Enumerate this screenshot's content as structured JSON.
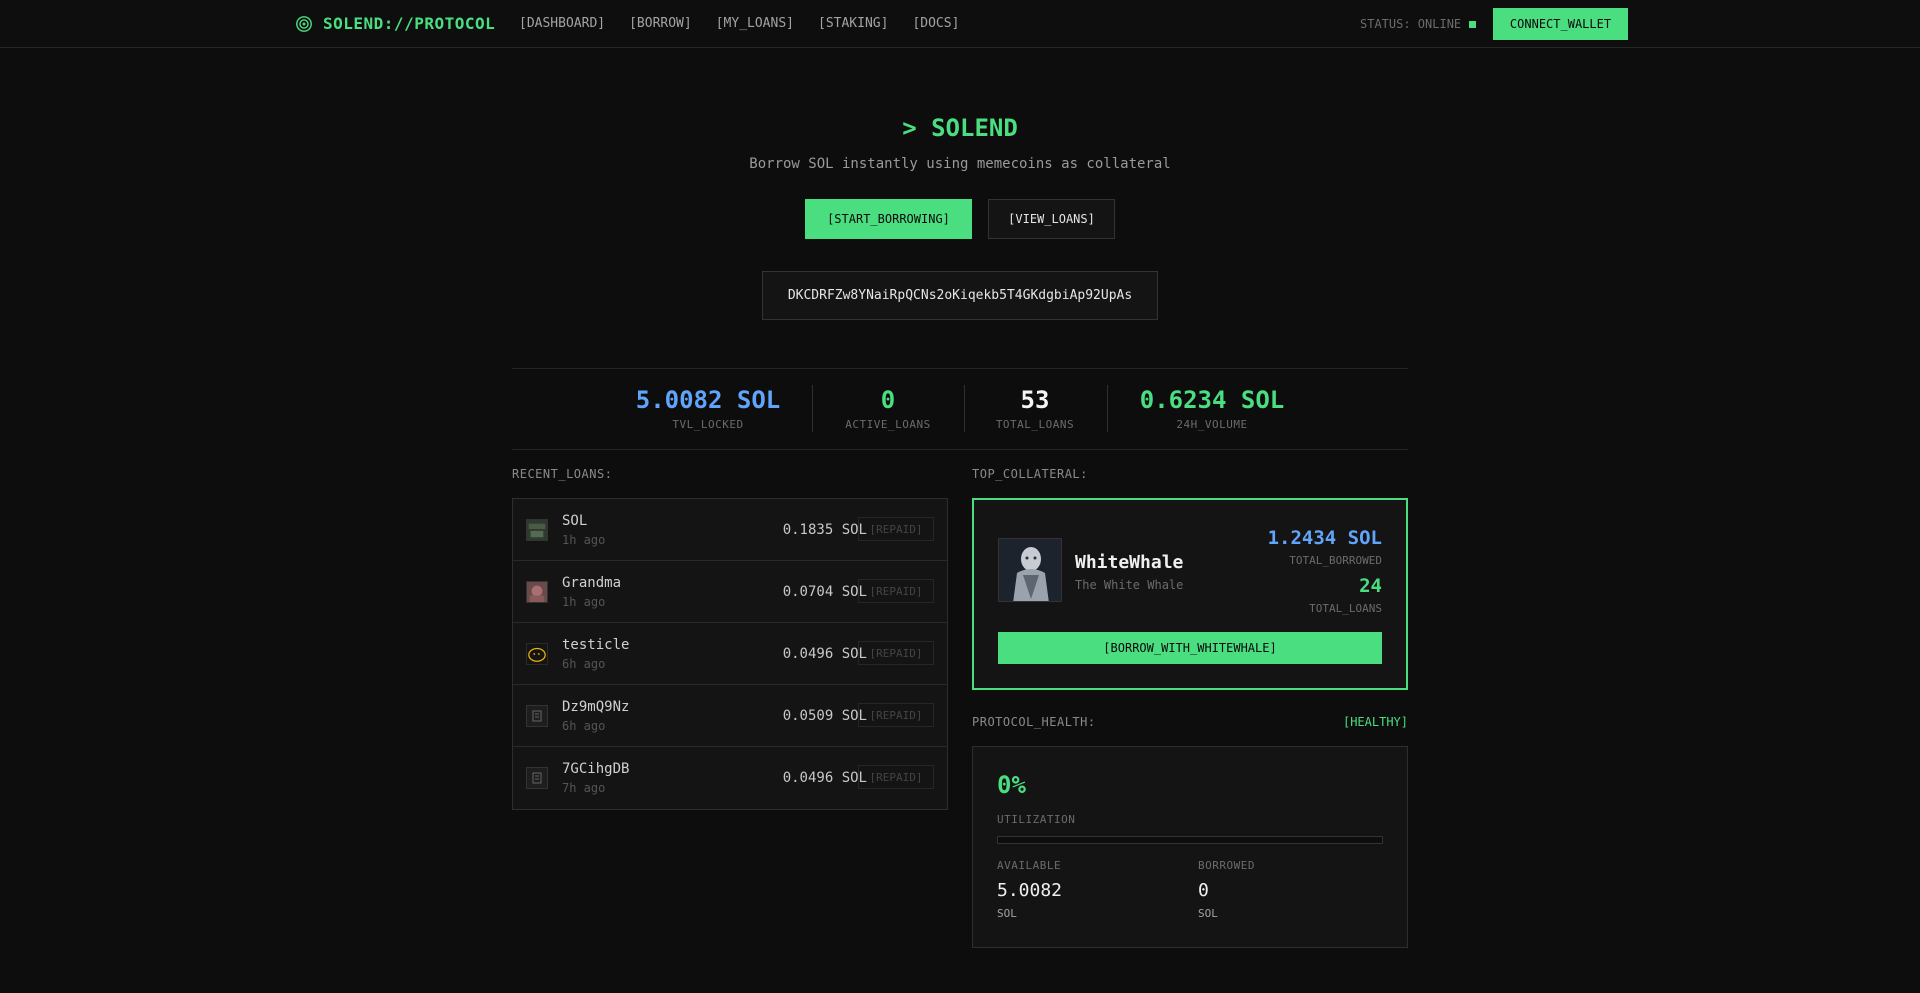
{
  "nav": {
    "brand": "SOLEND://PROTOCOL",
    "links": [
      "[DASHBOARD]",
      "[BORROW]",
      "[MY_LOANS]",
      "[STAKING]",
      "[DOCS]"
    ],
    "status": "STATUS: ONLINE",
    "connect_label": "CONNECT_WALLET"
  },
  "hero": {
    "title": "> SOLEND",
    "subtitle": "Borrow SOL instantly using memecoins as collateral",
    "primary_label": "[START_BORROWING]",
    "secondary_label": "[VIEW_LOANS]",
    "address": "DKCDRFZw8YNaiRpQCNs2oKiqekb5T4GKdgbiAp92UpAs"
  },
  "stats": [
    {
      "value": "5.0082 SOL",
      "label": "TVL_LOCKED",
      "color": "#60a5fa"
    },
    {
      "value": "0",
      "label": "ACTIVE_LOANS",
      "color": "#4ade80"
    },
    {
      "value": "53",
      "label": "TOTAL_LOANS",
      "color": "#f5f5f5"
    },
    {
      "value": "0.6234 SOL",
      "label": "24H_VOLUME",
      "color": "#4ade80"
    }
  ],
  "recent_loans": {
    "label": "RECENT_LOANS:",
    "items": [
      {
        "name": "SOL",
        "time": "1h ago",
        "amount": "0.1835 SOL",
        "status": "[REPAID]"
      },
      {
        "name": "Grandma",
        "time": "1h ago",
        "amount": "0.0704 SOL",
        "status": "[REPAID]"
      },
      {
        "name": "testicle",
        "time": "6h ago",
        "amount": "0.0496 SOL",
        "status": "[REPAID]"
      },
      {
        "name": "Dz9mQ9Nz",
        "time": "6h ago",
        "amount": "0.0509 SOL",
        "status": "[REPAID]"
      },
      {
        "name": "7GCihgDB",
        "time": "7h ago",
        "amount": "0.0496 SOL",
        "status": "[REPAID]"
      }
    ]
  },
  "top_collateral": {
    "label": "TOP_COLLATERAL:",
    "name": "WhiteWhale",
    "description": "The White Whale",
    "borrowed": "1.2434 SOL",
    "borrowed_label": "TOTAL_BORROWED",
    "loans": "24",
    "loans_label": "TOTAL_LOANS",
    "button_label": "[BORROW_WITH_WHITEWHALE]"
  },
  "health": {
    "label": "PROTOCOL_HEALTH:",
    "status": "[HEALTHY]",
    "utilization": "0%",
    "utilization_fraction": 0,
    "utilization_label": "UTILIZATION",
    "available_label": "AVAILABLE",
    "available_value": "5.0082",
    "available_unit": "SOL",
    "borrowed_label": "BORROWED",
    "borrowed_value": "0",
    "borrowed_unit": "SOL"
  },
  "colors": {
    "accent": "#4ade80",
    "blue": "#60a5fa",
    "background": "#0d0d0d"
  }
}
